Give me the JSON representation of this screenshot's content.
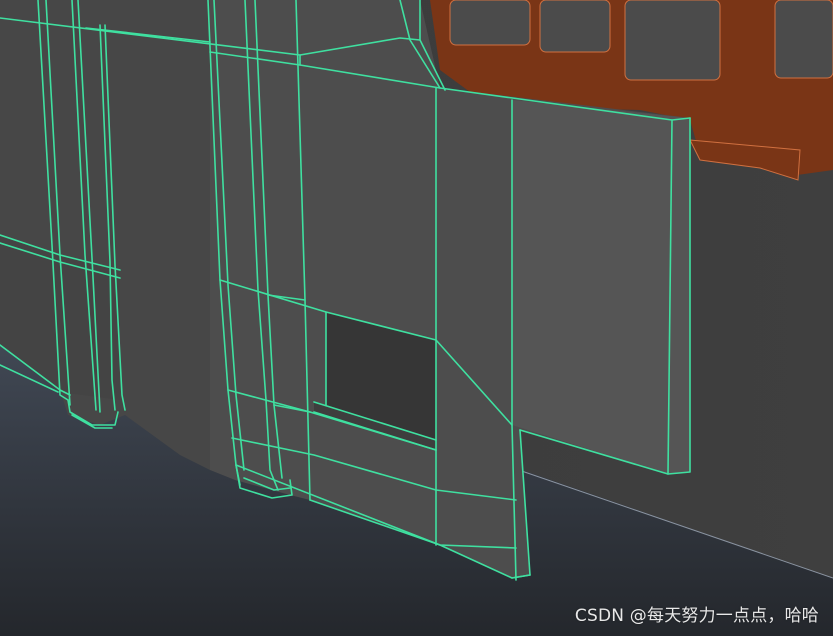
{
  "watermark": {
    "text": "CSDN @每天努力一点点，哈哈"
  },
  "colors": {
    "wireframe": "#3fe0a0",
    "mesh_face": "#4b4b4b",
    "wall": "#3c3c3c",
    "floor_top": "#3d444f",
    "floor_bottom": "#24272c",
    "rust": "#7a3516",
    "rust_inner": "#4b4b4b"
  }
}
